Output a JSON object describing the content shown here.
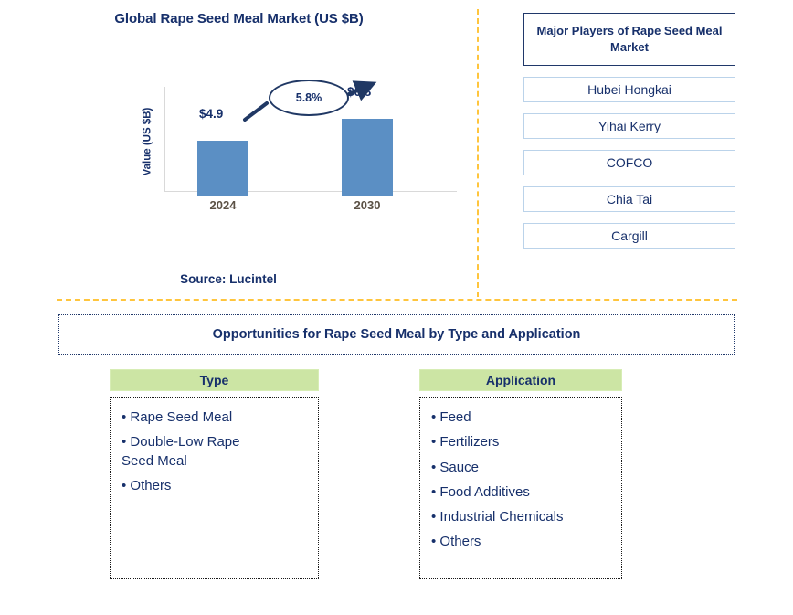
{
  "chart_panel": {
    "title": "Global Rape Seed Meal Market (US $B)",
    "source": "Source: Lucintel"
  },
  "chart_data": {
    "type": "bar",
    "title": "Global Rape Seed Meal Market (US $B)",
    "xlabel": "",
    "ylabel": "Value (US $B)",
    "categories": [
      "2024",
      "2030"
    ],
    "values": [
      4.9,
      6.8
    ],
    "value_labels": [
      "$4.9",
      "$6.8"
    ],
    "ylim": [
      0,
      8
    ],
    "grid": false,
    "legend": false,
    "bar_color": "#5B8FC4",
    "annotation": {
      "label": "5.8%",
      "meaning": "CAGR",
      "shape": "ellipse-with-arrow"
    }
  },
  "players": {
    "header": "Major Players of Rape Seed Meal Market",
    "items": [
      "Hubei Hongkai",
      "Yihai Kerry",
      "COFCO",
      "Chia Tai",
      "Cargill"
    ]
  },
  "opportunities": {
    "banner": "Opportunities for Rape Seed Meal by Type and Application",
    "columns": [
      {
        "header": "Type",
        "items": [
          "Rape Seed Meal",
          "Double-Low Rape\nSeed Meal",
          "Others"
        ]
      },
      {
        "header": "Application",
        "items": [
          "Feed",
          "Fertilizers",
          "Sauce",
          "Food Additives",
          "Industrial Chemicals",
          "Others"
        ]
      }
    ]
  },
  "colors": {
    "navy": "#17306B",
    "bar_blue": "#5B8FC4",
    "divider_orange": "#FFC53D",
    "header_green": "#CCE5A4",
    "player_border": "#BBD3EA"
  }
}
